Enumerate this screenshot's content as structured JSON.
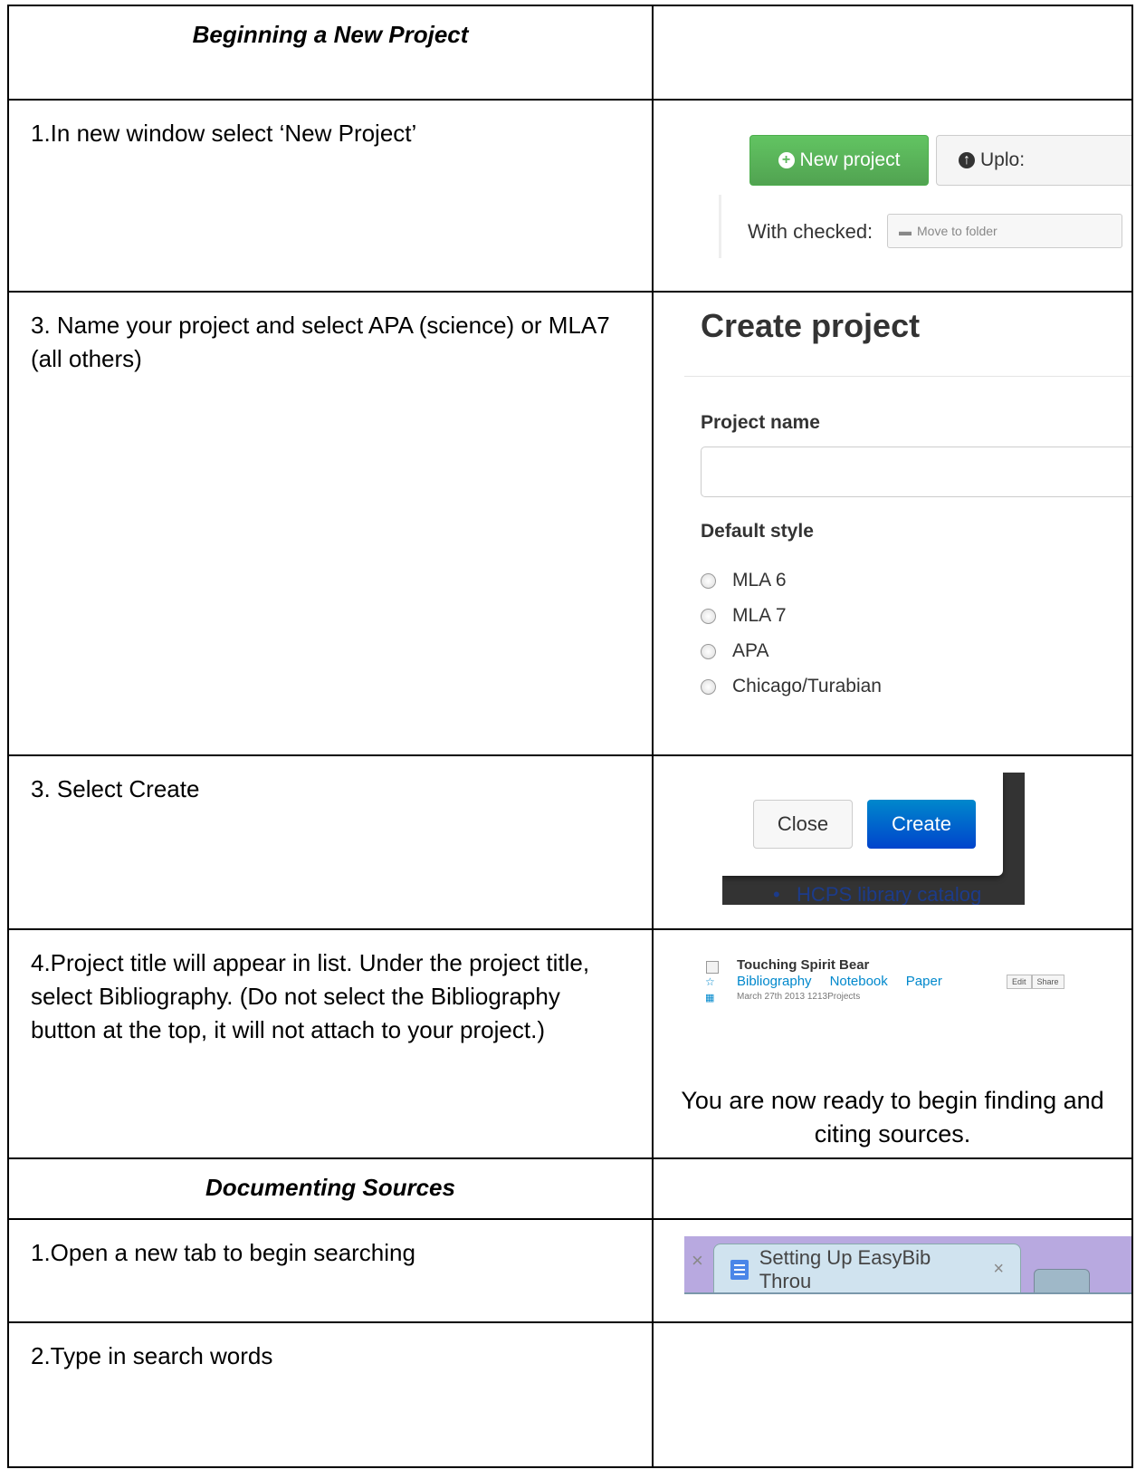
{
  "rows": {
    "r1": {
      "left": "Beginning a New Project"
    },
    "r2": {
      "left": "1.In new window select ‘New Project’",
      "new_project": "New project",
      "upload": "Uplo:",
      "with_checked": "With checked:",
      "move_to_folder": "Move to folder"
    },
    "r3": {
      "left": "3. Name your project and select APA (science) or MLA7 (all others)",
      "title": "Create project",
      "project_name_label": "Project name",
      "default_style_label": "Default style",
      "styles": [
        "MLA 6",
        "MLA 7",
        "APA",
        "Chicago/Turabian"
      ]
    },
    "r4": {
      "left": "3.  Select Create",
      "close": "Close",
      "create": "Create",
      "bg_link": "HCPS library catalog"
    },
    "r5": {
      "left": "4.Project title will appear in list.  Under the project title, select Bibliography.  (Do not select the Bibliography button at the top, it will not attach to your project.)",
      "project_title": "Touching Spirit Bear",
      "links": [
        "Bibliography",
        "Notebook",
        "Paper"
      ],
      "date": "March 27th 2013 1213Projects",
      "edit": "Edit",
      "share": "Share",
      "ready": "You are now ready to begin finding and citing sources."
    },
    "r6": {
      "left": "Documenting Sources"
    },
    "r7": {
      "left": "1.Open a new tab to begin searching",
      "tab_title": "Setting Up EasyBib Throu",
      "close_mark": "×"
    },
    "r8": {
      "left": "2.Type in search words"
    }
  }
}
